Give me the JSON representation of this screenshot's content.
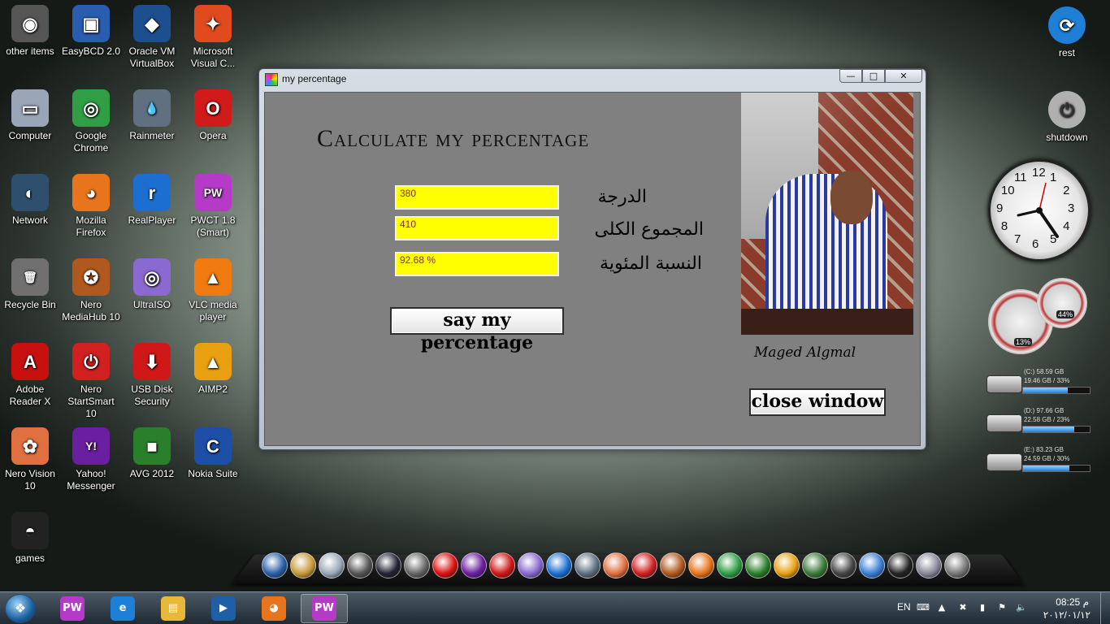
{
  "desktop": {
    "left_icons": [
      {
        "label": "other items",
        "icon": "folder-stack-icon",
        "color": "#555555"
      },
      {
        "label": "EasyBCD 2.0",
        "icon": "computer-box-icon",
        "color": "#2a5db0"
      },
      {
        "label": "Oracle VM VirtualBox",
        "icon": "virtualbox-cube-icon",
        "color": "#1d4f8f"
      },
      {
        "label": "Microsoft Visual C...",
        "icon": "visual-studio-icon",
        "color": "#e04a1e"
      },
      {
        "label": "Computer",
        "icon": "monitor-icon",
        "color": "#9aa5b8"
      },
      {
        "label": "Google Chrome",
        "icon": "chrome-icon",
        "color": "#2f9e44"
      },
      {
        "label": "Rainmeter",
        "icon": "water-drop-icon",
        "color": "#607080"
      },
      {
        "label": "Opera",
        "icon": "opera-icon",
        "color": "#d11a1a"
      },
      {
        "label": "Network",
        "icon": "network-globe-icon",
        "color": "#2f4f6f"
      },
      {
        "label": "Mozilla Firefox",
        "icon": "firefox-icon",
        "color": "#e8741b"
      },
      {
        "label": "RealPlayer",
        "icon": "realplayer-icon",
        "color": "#1c6fd1"
      },
      {
        "label": "PWCT 1.8 (Smart)",
        "icon": "pwct-icon",
        "color": "#b43ac7"
      },
      {
        "label": "Recycle Bin",
        "icon": "recycle-bin-icon",
        "color": "#707070"
      },
      {
        "label": "Nero MediaHub 10",
        "icon": "nero-mediahub-icon",
        "color": "#b0591e"
      },
      {
        "label": "UltraISO",
        "icon": "disc-icon",
        "color": "#8a6ad0"
      },
      {
        "label": "VLC media player",
        "icon": "vlc-cone-icon",
        "color": "#f07a10"
      },
      {
        "label": "Adobe Reader X",
        "icon": "pdf-icon",
        "color": "#c81010"
      },
      {
        "label": "Nero StartSmart 10",
        "icon": "power-button-icon",
        "color": "#d02020"
      },
      {
        "label": "USB Disk Security",
        "icon": "arrow-down-icon",
        "color": "#d01818"
      },
      {
        "label": "AIMP2",
        "icon": "aimp-icon",
        "color": "#e8a010"
      },
      {
        "label": "Nero Vision 10",
        "icon": "nero-vision-icon",
        "color": "#e07040"
      },
      {
        "label": "Yahoo! Messenger",
        "icon": "yahoo-smiley-icon",
        "color": "#6a1fa0"
      },
      {
        "label": "AVG 2012",
        "icon": "avg-icon",
        "color": "#2a7f2a"
      },
      {
        "label": "Nokia Suite",
        "icon": "nokia-suite-icon",
        "color": "#1e4fa8"
      },
      {
        "label": "games",
        "icon": "game-mask-icon",
        "color": "#222222"
      }
    ],
    "right_icons": [
      {
        "label": "rest",
        "icon": "refresh-icon",
        "color": "#1f7fd6"
      },
      {
        "label": "shutdown",
        "icon": "power-icon",
        "color": "#b0b0b0"
      }
    ]
  },
  "window": {
    "title": "my percentage",
    "controls": {
      "minimize": "—",
      "maximize": "□",
      "close": "✕"
    },
    "heading": "Calculate my percentage",
    "fields": [
      {
        "label": "الدرجة",
        "value": "380"
      },
      {
        "label": "المجموع الكلى",
        "value": "410"
      },
      {
        "label": "النسبة المئوية",
        "value": "92.68 %"
      }
    ],
    "calc_button": "say my percentage",
    "close_button": "close window",
    "signature": "Maged Algmal",
    "field_color": "#ffff00"
  },
  "gadgets": {
    "clock_numbers": [
      "12",
      "1",
      "2",
      "3",
      "4",
      "5",
      "6",
      "7",
      "8",
      "9",
      "10",
      "11"
    ],
    "cpu": "13%",
    "ram": "44%",
    "drives": [
      {
        "name": "(C:) 58.59 GB",
        "free": "19.46 GB / 33%",
        "percent": 0.67
      },
      {
        "name": "(D:) 97.66 GB",
        "free": "22.58 GB / 23%",
        "percent": 0.77
      },
      {
        "name": "(E:) 83.23 GB",
        "free": "24.59 GB / 30%",
        "percent": 0.7
      }
    ]
  },
  "dock": {
    "icons": [
      "steam-icon",
      "quick-tools-icon",
      "disc-burner-icon",
      "trash-icon",
      "network-icon",
      "folder-icon",
      "opera-icon",
      "yahoo-icon",
      "usb-security-icon",
      "ultraiso-icon",
      "realplayer-icon",
      "rainmeter-icon",
      "nero-vision-icon",
      "nero-startsmart-icon",
      "nero-mediahub-icon",
      "firefox-icon",
      "chrome-icon",
      "avg-icon",
      "aimp-icon",
      "photo-tools-icon",
      "clock-icon",
      "globe-icon",
      "tuxedo-icon",
      "gear-icon",
      "recycle-bin-icon"
    ]
  },
  "taskbar": {
    "apps": [
      {
        "name": "pwct-task",
        "icon": "pwct-icon",
        "color": "#b43ac7"
      },
      {
        "name": "internet-explorer",
        "icon": "ie-icon",
        "color": "#1e7fd8"
      },
      {
        "name": "explorer",
        "icon": "folder-icon",
        "color": "#e8b838"
      },
      {
        "name": "media-player",
        "icon": "media-player-icon",
        "color": "#1f5fa8"
      },
      {
        "name": "firefox",
        "icon": "firefox-icon",
        "color": "#e8741b"
      },
      {
        "name": "pwct-active",
        "icon": "pwct-icon",
        "color": "#b43ac7"
      }
    ],
    "language": "EN",
    "time": "08:25 م",
    "date": "٢٠١٢/٠١/١٢"
  }
}
